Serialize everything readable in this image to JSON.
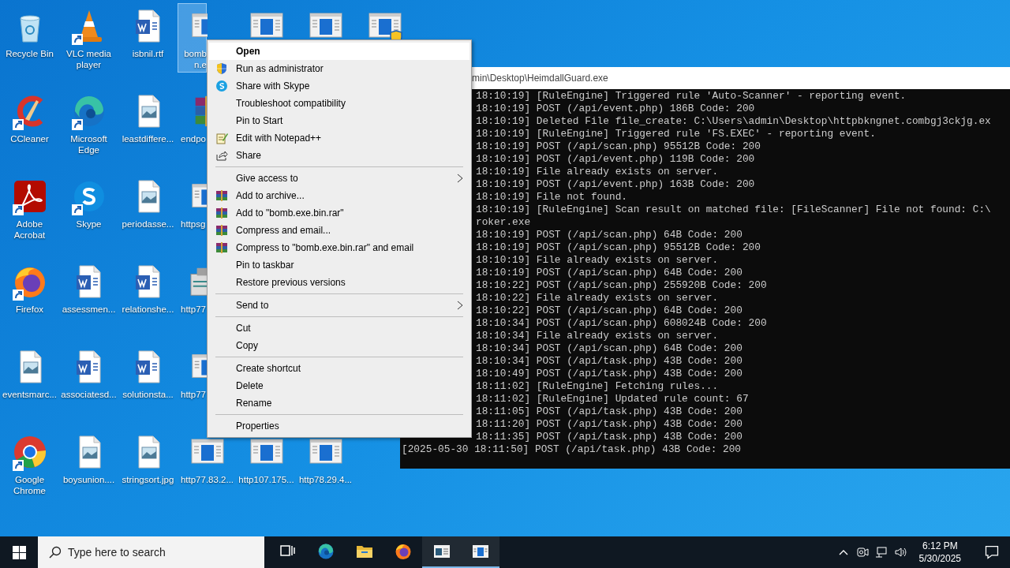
{
  "desktop": {
    "rows": [
      [
        {
          "kind": "recycle",
          "label": "Recycle Bin",
          "shortcut": false,
          "selected": false
        },
        {
          "kind": "vlc",
          "label": "VLC media player",
          "shortcut": true,
          "selected": false
        },
        {
          "kind": "word",
          "label": "isbnil.rtf",
          "shortcut": false,
          "selected": false
        },
        {
          "kind": "exe",
          "label": "bomb n.e",
          "shortcut": false,
          "selected": true
        },
        {
          "kind": "exe",
          "shortcut": false,
          "selected": false
        },
        {
          "kind": "exe",
          "shortcut": false,
          "selected": false
        },
        {
          "kind": "exe-shield",
          "shortcut": false,
          "selected": false
        }
      ],
      [
        {
          "kind": "ccleaner",
          "label": "CCleaner",
          "shortcut": true,
          "selected": false
        },
        {
          "kind": "edge",
          "label": "Microsoft Edge",
          "shortcut": true,
          "selected": false
        },
        {
          "kind": "image",
          "label": "leastdiffere...",
          "shortcut": false,
          "selected": false
        },
        {
          "kind": "winrar",
          "label": "endpo",
          "shortcut": false,
          "selected": false
        }
      ],
      [
        {
          "kind": "acrobat",
          "label": "Adobe Acrobat",
          "shortcut": true,
          "selected": false
        },
        {
          "kind": "skype",
          "label": "Skype",
          "shortcut": true,
          "selected": false
        },
        {
          "kind": "image",
          "label": "periodasse...",
          "shortcut": false,
          "selected": false
        },
        {
          "kind": "exe",
          "label": "httpsg",
          "shortcut": false,
          "selected": false
        }
      ],
      [
        {
          "kind": "firefox",
          "label": "Firefox",
          "shortcut": true,
          "selected": false
        },
        {
          "kind": "word",
          "label": "assessmen...",
          "shortcut": false,
          "selected": false
        },
        {
          "kind": "word",
          "label": "relationshe...",
          "shortcut": false,
          "selected": false
        },
        {
          "kind": "installer",
          "label": "http77",
          "shortcut": false,
          "selected": false
        }
      ],
      [
        {
          "kind": "image",
          "label": "eventsmarc...",
          "shortcut": false,
          "selected": false
        },
        {
          "kind": "word",
          "label": "associatesd...",
          "shortcut": false,
          "selected": false
        },
        {
          "kind": "word",
          "label": "solutionsta...",
          "shortcut": false,
          "selected": false
        },
        {
          "kind": "exe",
          "label": "http77",
          "shortcut": false,
          "selected": false
        }
      ],
      [
        {
          "kind": "chrome",
          "label": "Google Chrome",
          "shortcut": true,
          "selected": false
        },
        {
          "kind": "image",
          "label": "boysunion....",
          "shortcut": false,
          "selected": false
        },
        {
          "kind": "image",
          "label": "stringsort.jpg",
          "shortcut": false,
          "selected": false
        },
        {
          "kind": "exe",
          "label": "http77.83.2...",
          "shortcut": false,
          "selected": false
        },
        {
          "kind": "exe",
          "label": "http107.175...",
          "shortcut": false,
          "selected": false
        },
        {
          "kind": "exe",
          "label": "http78.29.4...",
          "shortcut": false,
          "selected": false
        }
      ]
    ]
  },
  "console": {
    "title": "min\\Desktop\\HeimdallGuard.exe",
    "covered_lines": [
      "18:10:19] [RuleEngine] Triggered rule 'Auto-Scanner' - reporting event.",
      "18:10:19] POST (/api/event.php) 186B Code: 200",
      "18:10:19] Deleted File file_create: C:\\Users\\admin\\Desktop\\httpbkngnet.combgj3ckjg.ex",
      "18:10:19] [RuleEngine] Triggered rule 'FS.EXEC' - reporting event.",
      "18:10:19] POST (/api/scan.php) 95512B Code: 200",
      "18:10:19] POST (/api/event.php) 119B Code: 200",
      "18:10:19] File already exists on server.",
      "18:10:19] POST (/api/event.php) 163B Code: 200",
      "18:10:19] File not found.",
      "18:10:19] [RuleEngine] Scan result on matched file: [FileScanner] File not found: C:\\",
      "roker.exe",
      "18:10:19] POST (/api/scan.php) 64B Code: 200",
      "18:10:19] POST (/api/scan.php) 95512B Code: 200",
      "18:10:19] File already exists on server.",
      "18:10:19] POST (/api/scan.php) 64B Code: 200",
      "18:10:22] POST (/api/scan.php) 255920B Code: 200",
      "18:10:22] File already exists on server.",
      "18:10:22] POST (/api/scan.php) 64B Code: 200",
      "18:10:34] POST (/api/scan.php) 608024B Code: 200",
      "18:10:34] File already exists on server.",
      "18:10:34] POST (/api/scan.php) 64B Code: 200",
      "18:10:34] POST (/api/task.php) 43B Code: 200",
      "18:10:49] POST (/api/task.php) 43B Code: 200",
      "18:11:02] [RuleEngine] Fetching rules...",
      "18:11:02] [RuleEngine] Updated rule count: 67",
      "18:11:05] POST (/api/task.php) 43B Code: 200",
      "18:11:20] POST (/api/task.php) 43B Code: 200",
      "18:11:35] POST (/api/task.php) 43B Code: 200"
    ],
    "full_lines": [
      "[2025-05-30 18:11:50] POST (/api/task.php) 43B Code: 200"
    ]
  },
  "context_menu": {
    "groups": [
      [
        {
          "label": "Open",
          "default": true,
          "selected": true
        },
        {
          "label": "Run as administrator",
          "kind": "shield",
          "default": false,
          "selected": false
        },
        {
          "label": "Share with Skype",
          "kind": "skype",
          "default": false,
          "selected": false
        },
        {
          "label": "Troubleshoot compatibility",
          "default": false,
          "selected": false
        },
        {
          "label": "Pin to Start",
          "default": false,
          "selected": false
        },
        {
          "label": "Edit with Notepad++",
          "kind": "notepad",
          "default": false,
          "selected": false
        },
        {
          "label": "Share",
          "kind": "share",
          "default": false,
          "selected": false
        }
      ],
      [
        {
          "label": "Give access to",
          "submenu": true,
          "default": false,
          "selected": false
        },
        {
          "label": "Add to archive...",
          "kind": "winrar",
          "default": false,
          "selected": false
        },
        {
          "label": "Add to \"bomb.exe.bin.rar\"",
          "kind": "winrar",
          "default": false,
          "selected": false
        },
        {
          "label": "Compress and email...",
          "kind": "winrar",
          "default": false,
          "selected": false
        },
        {
          "label": "Compress to \"bomb.exe.bin.rar\" and email",
          "kind": "winrar",
          "default": false,
          "selected": false
        },
        {
          "label": "Pin to taskbar",
          "default": false,
          "selected": false
        },
        {
          "label": "Restore previous versions",
          "default": false,
          "selected": false
        }
      ],
      [
        {
          "label": "Send to",
          "submenu": true,
          "default": false,
          "selected": false
        }
      ],
      [
        {
          "label": "Cut",
          "default": false,
          "selected": false
        },
        {
          "label": "Copy",
          "default": false,
          "selected": false
        }
      ],
      [
        {
          "label": "Create shortcut",
          "default": false,
          "selected": false
        },
        {
          "label": "Delete",
          "default": false,
          "selected": false
        },
        {
          "label": "Rename",
          "default": false,
          "selected": false
        }
      ],
      [
        {
          "label": "Properties",
          "default": false,
          "selected": false
        }
      ]
    ]
  },
  "taskbar": {
    "search": {
      "placeholder": "Type here to search"
    },
    "apps": [
      {
        "kind": "taskview",
        "running": false
      },
      {
        "kind": "edge",
        "running": false
      },
      {
        "kind": "explorer",
        "running": false
      },
      {
        "kind": "firefox",
        "running": false
      },
      {
        "kind": "console",
        "running": true
      },
      {
        "kind": "exe",
        "running": true
      }
    ],
    "clock": {
      "time": "6:12 PM",
      "date": "5/30/2025"
    }
  }
}
